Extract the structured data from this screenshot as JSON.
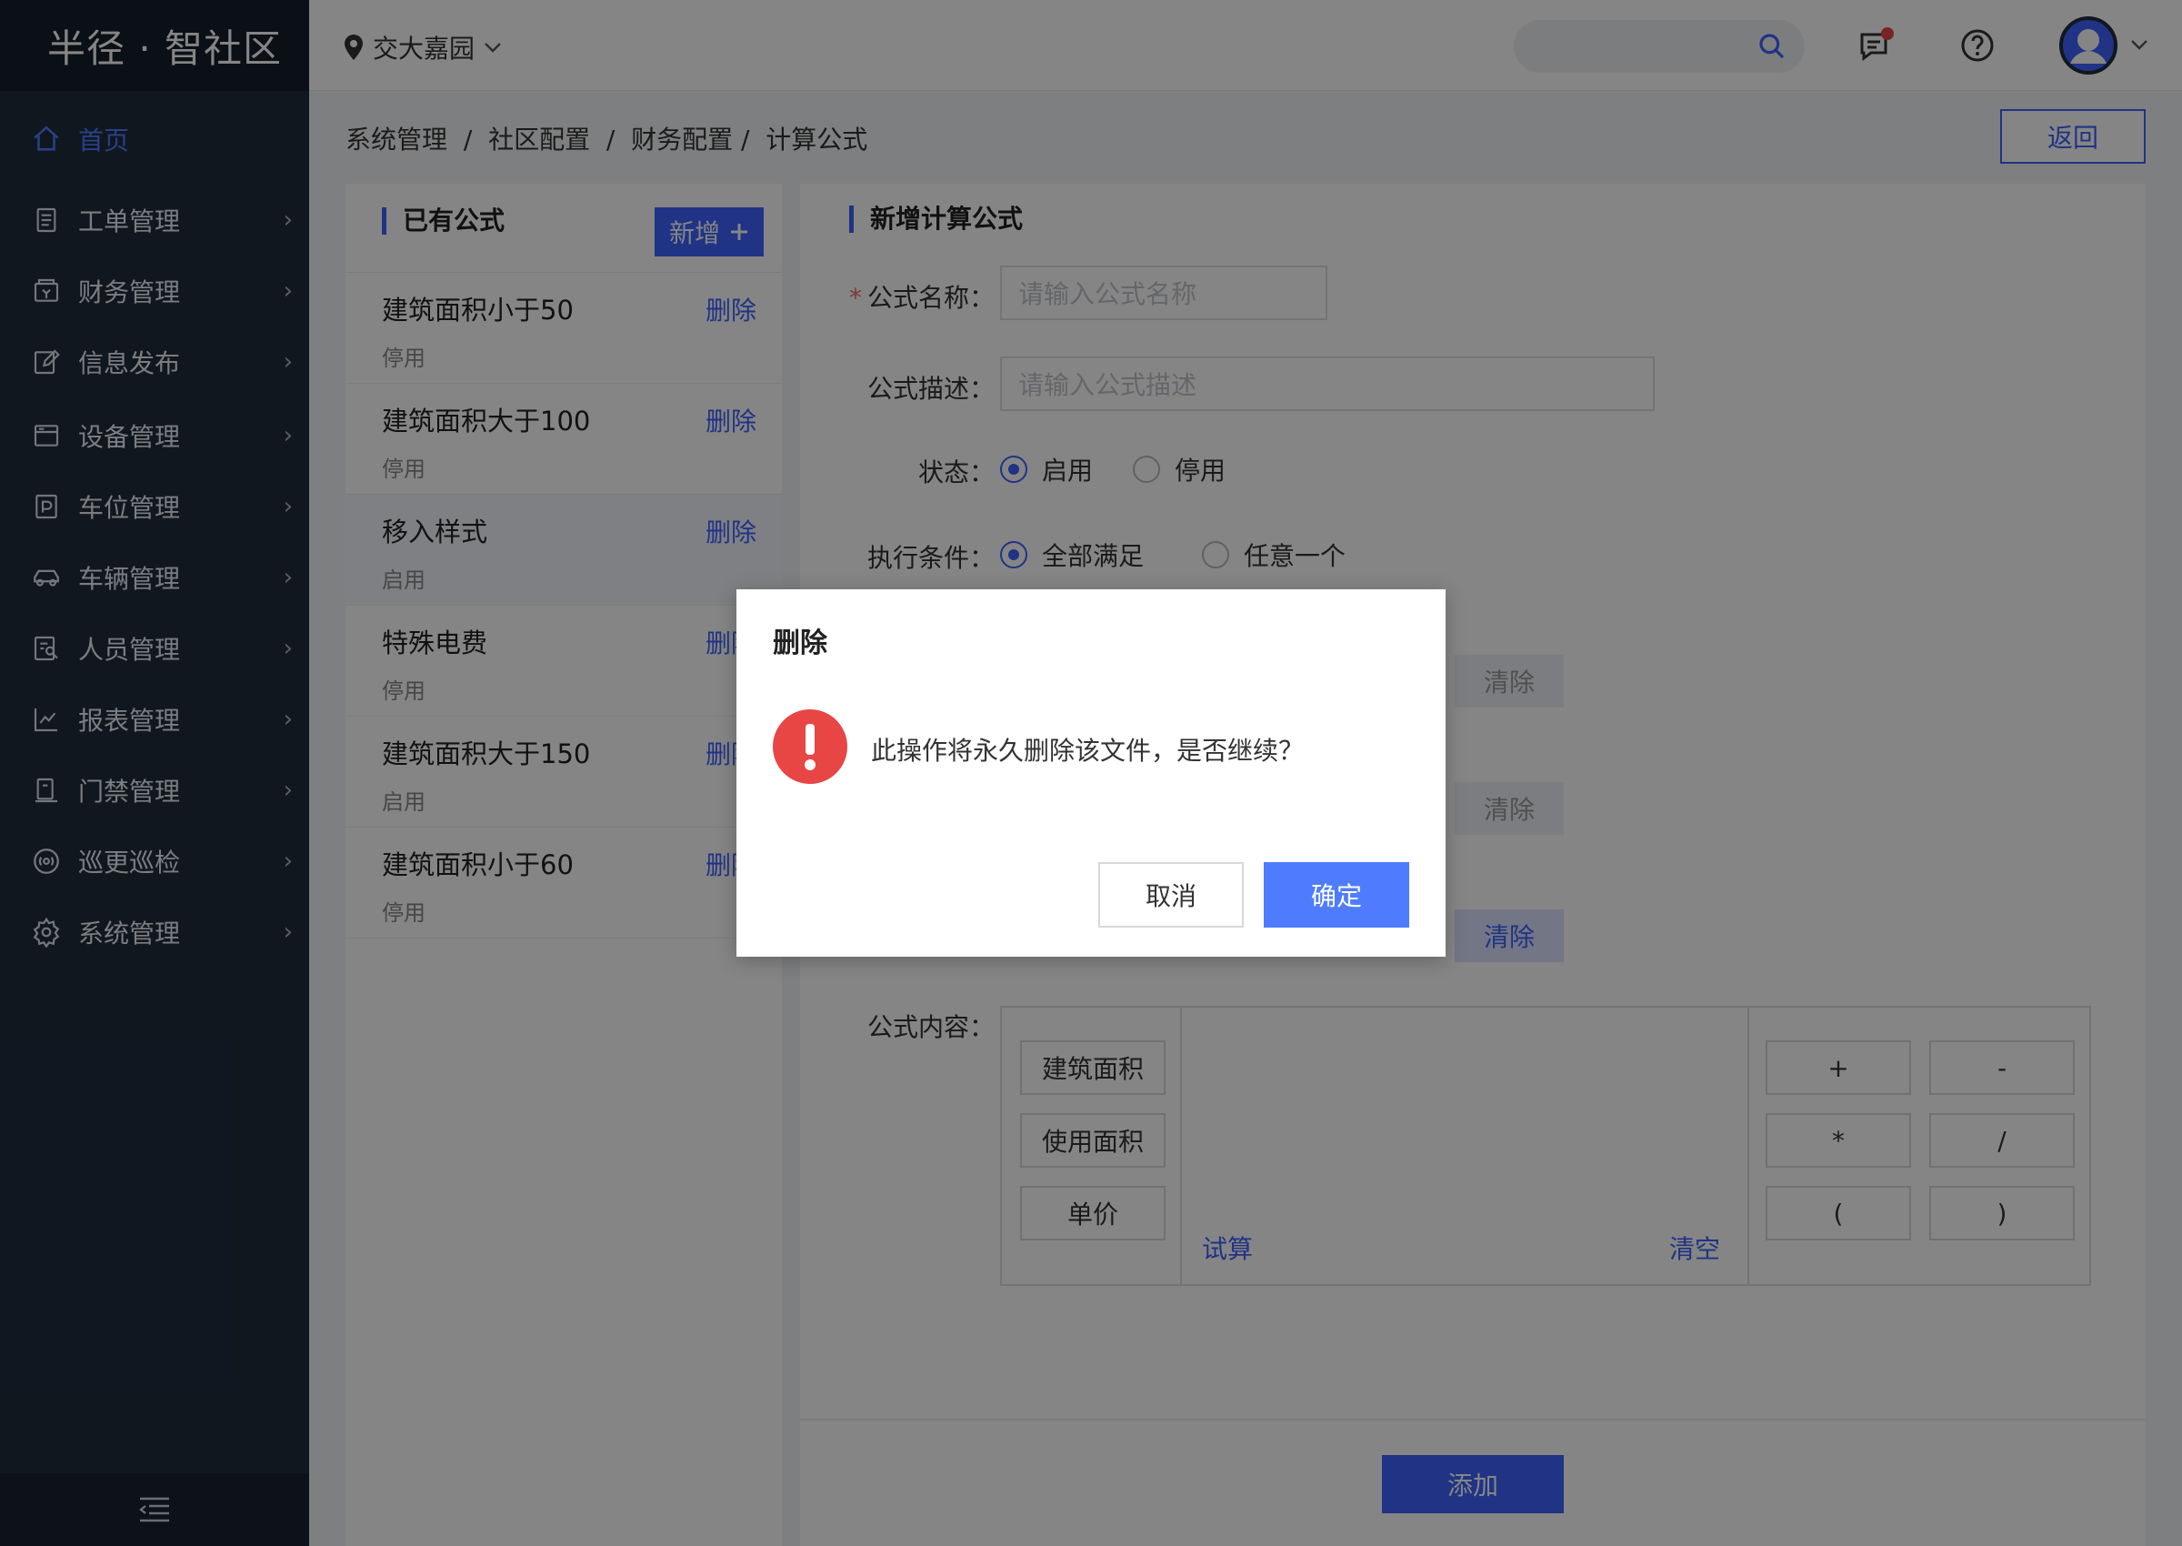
{
  "app": {
    "logo": "半径 · 智社区"
  },
  "header": {
    "location": "交大嘉园"
  },
  "sidebar": {
    "items": [
      {
        "label": "首页",
        "icon": "home-icon",
        "active": true
      },
      {
        "label": "工单管理",
        "icon": "clipboard-icon"
      },
      {
        "label": "财务管理",
        "icon": "wallet-icon"
      },
      {
        "label": "信息发布",
        "icon": "edit-icon"
      },
      {
        "label": "设备管理",
        "icon": "device-icon"
      },
      {
        "label": "车位管理",
        "icon": "parking-icon"
      },
      {
        "label": "车辆管理",
        "icon": "car-icon"
      },
      {
        "label": "人员管理",
        "icon": "person-search-icon"
      },
      {
        "label": "报表管理",
        "icon": "chart-icon"
      },
      {
        "label": "门禁管理",
        "icon": "access-icon"
      },
      {
        "label": "巡更巡检",
        "icon": "patrol-icon"
      },
      {
        "label": "系统管理",
        "icon": "gear-icon"
      }
    ]
  },
  "breadcrumb": {
    "b1": "系统管理",
    "b2": "社区配置",
    "b3": "财务配置",
    "b4": "计算公式"
  },
  "back_label": "返回",
  "left_panel": {
    "title": "已有公式",
    "new_label": "新增",
    "delete_label": "删除",
    "items": [
      {
        "name": "建筑面积小于50",
        "status": "停用"
      },
      {
        "name": "建筑面积大于100",
        "status": "停用"
      },
      {
        "name": "移入样式",
        "status": "启用"
      },
      {
        "name": "特殊电费",
        "status": "停用"
      },
      {
        "name": "建筑面积大于150",
        "status": "启用"
      },
      {
        "name": "建筑面积小于60",
        "status": "停用"
      }
    ]
  },
  "form": {
    "title": "新增计算公式",
    "name_label": "公式名称：",
    "name_placeholder": "请输入公式名称",
    "desc_label": "公式描述：",
    "desc_placeholder": "请输入公式描述",
    "status_label": "状态：",
    "status_on": "启用",
    "status_off": "停用",
    "cond_label": "执行条件：",
    "cond_all": "全部满足",
    "cond_any": "任意一个",
    "clear_label": "清除",
    "content_label": "公式内容：",
    "vars": [
      "建筑面积",
      "使用面积",
      "单价"
    ],
    "ops": [
      "+",
      "-",
      "*",
      "/",
      "(",
      ")"
    ],
    "try_label": "试算",
    "empty_label": "清空",
    "add_label": "添加"
  },
  "dialog": {
    "title": "删除",
    "message": "此操作将永久删除该文件，是否继续？",
    "cancel": "取消",
    "ok": "确定"
  }
}
